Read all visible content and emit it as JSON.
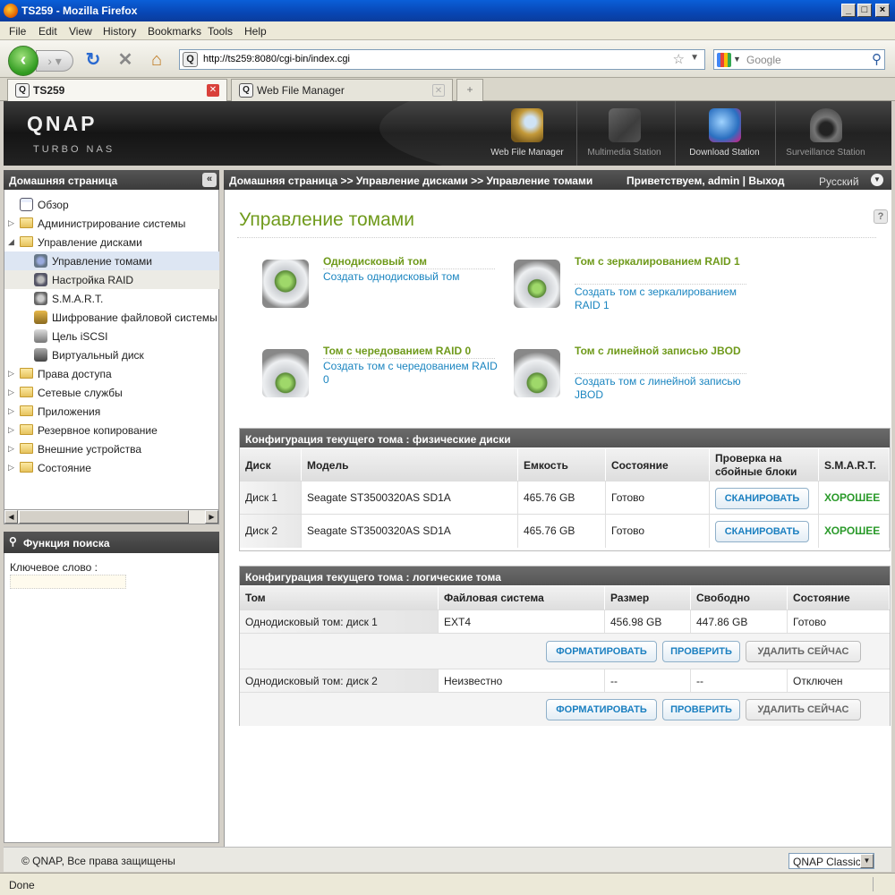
{
  "window": {
    "title": "TS259 - Mozilla Firefox"
  },
  "menu": [
    "File",
    "Edit",
    "View",
    "History",
    "Bookmarks",
    "Tools",
    "Help"
  ],
  "nav": {
    "url": "http://ts259:8080/cgi-bin/index.cgi",
    "search_placeholder": "Google"
  },
  "tabs": [
    {
      "label": "TS259",
      "active": true
    },
    {
      "label": "Web File Manager",
      "active": false
    }
  ],
  "header": {
    "logo": "QNAP",
    "subtitle": "TURBO NAS",
    "apps": [
      "Web File Manager",
      "Multimedia Station",
      "Download Station",
      "Surveillance Station"
    ]
  },
  "sidebar": {
    "title": "Домашняя страница",
    "items": [
      {
        "label": "Обзор"
      },
      {
        "label": "Администрирование системы"
      },
      {
        "label": "Управление дисками"
      },
      {
        "label": "Управление томами"
      },
      {
        "label": "Настройка RAID"
      },
      {
        "label": "S.M.A.R.T."
      },
      {
        "label": "Шифрование файловой системы"
      },
      {
        "label": "Цель iSCSI"
      },
      {
        "label": "Виртуальный диск"
      },
      {
        "label": "Права доступа"
      },
      {
        "label": "Сетевые службы"
      },
      {
        "label": "Приложения"
      },
      {
        "label": "Резервное копирование"
      },
      {
        "label": "Внешние устройства"
      },
      {
        "label": "Состояние"
      }
    ]
  },
  "search": {
    "title": "Функция поиска",
    "keyword_label": "Ключевое слово :"
  },
  "crumbbar": {
    "breadcrumb": "Домашняя страница >> Управление дисками >> Управление томами",
    "welcome": "Приветствуем, admin | Выход",
    "language": "Русский"
  },
  "main": {
    "title": "Управление томами",
    "volume_types": [
      {
        "heading": "Однодисковый том",
        "link": "Создать однодисковый том"
      },
      {
        "heading": "Том с зеркалированием RAID 1",
        "link": "Создать том с зеркалированием RAID 1"
      },
      {
        "heading": "Том с чередованием RAID 0",
        "link": "Создать том с чередованием RAID 0"
      },
      {
        "heading": "Том с линейной записью JBOD",
        "link": "Создать том с линейной записью JBOD"
      }
    ],
    "physical": {
      "title": "Конфигурация текущего тома : физические диски",
      "columns": [
        "Диск",
        "Модель",
        "Емкость",
        "Состояние",
        "Проверка на сбойные блоки",
        "S.M.A.R.T."
      ],
      "rows": [
        {
          "disk": "Диск 1",
          "model": "Seagate ST3500320AS SD1A",
          "capacity": "465.76 GB",
          "status": "Готово",
          "scan": "СКАНИРОВАТЬ",
          "smart": "ХОРОШЕЕ"
        },
        {
          "disk": "Диск 2",
          "model": "Seagate ST3500320AS SD1A",
          "capacity": "465.76 GB",
          "status": "Готово",
          "scan": "СКАНИРОВАТЬ",
          "smart": "ХОРОШЕЕ"
        }
      ]
    },
    "logical": {
      "title": "Конфигурация текущего тома : логические тома",
      "columns": [
        "Том",
        "Файловая система",
        "Размер",
        "Свободно",
        "Состояние"
      ],
      "rows": [
        {
          "volume": "Однодисковый том: диск 1",
          "fs": "EXT4",
          "size": "456.98 GB",
          "free": "447.86 GB",
          "status": "Готово"
        },
        {
          "volume": "Однодисковый том: диск 2",
          "fs": "Неизвестно",
          "size": "--",
          "free": "--",
          "status": "Отключен"
        }
      ],
      "buttons": {
        "format": "ФОРМАТИРОВАТЬ",
        "check": "ПРОВЕРИТЬ",
        "delete": "УДАЛИТЬ СЕЙЧАС"
      }
    }
  },
  "footer": {
    "copyright": "© QNAP, Все права защищены",
    "theme": "QNAP Classic"
  },
  "status": {
    "text": "Done"
  }
}
